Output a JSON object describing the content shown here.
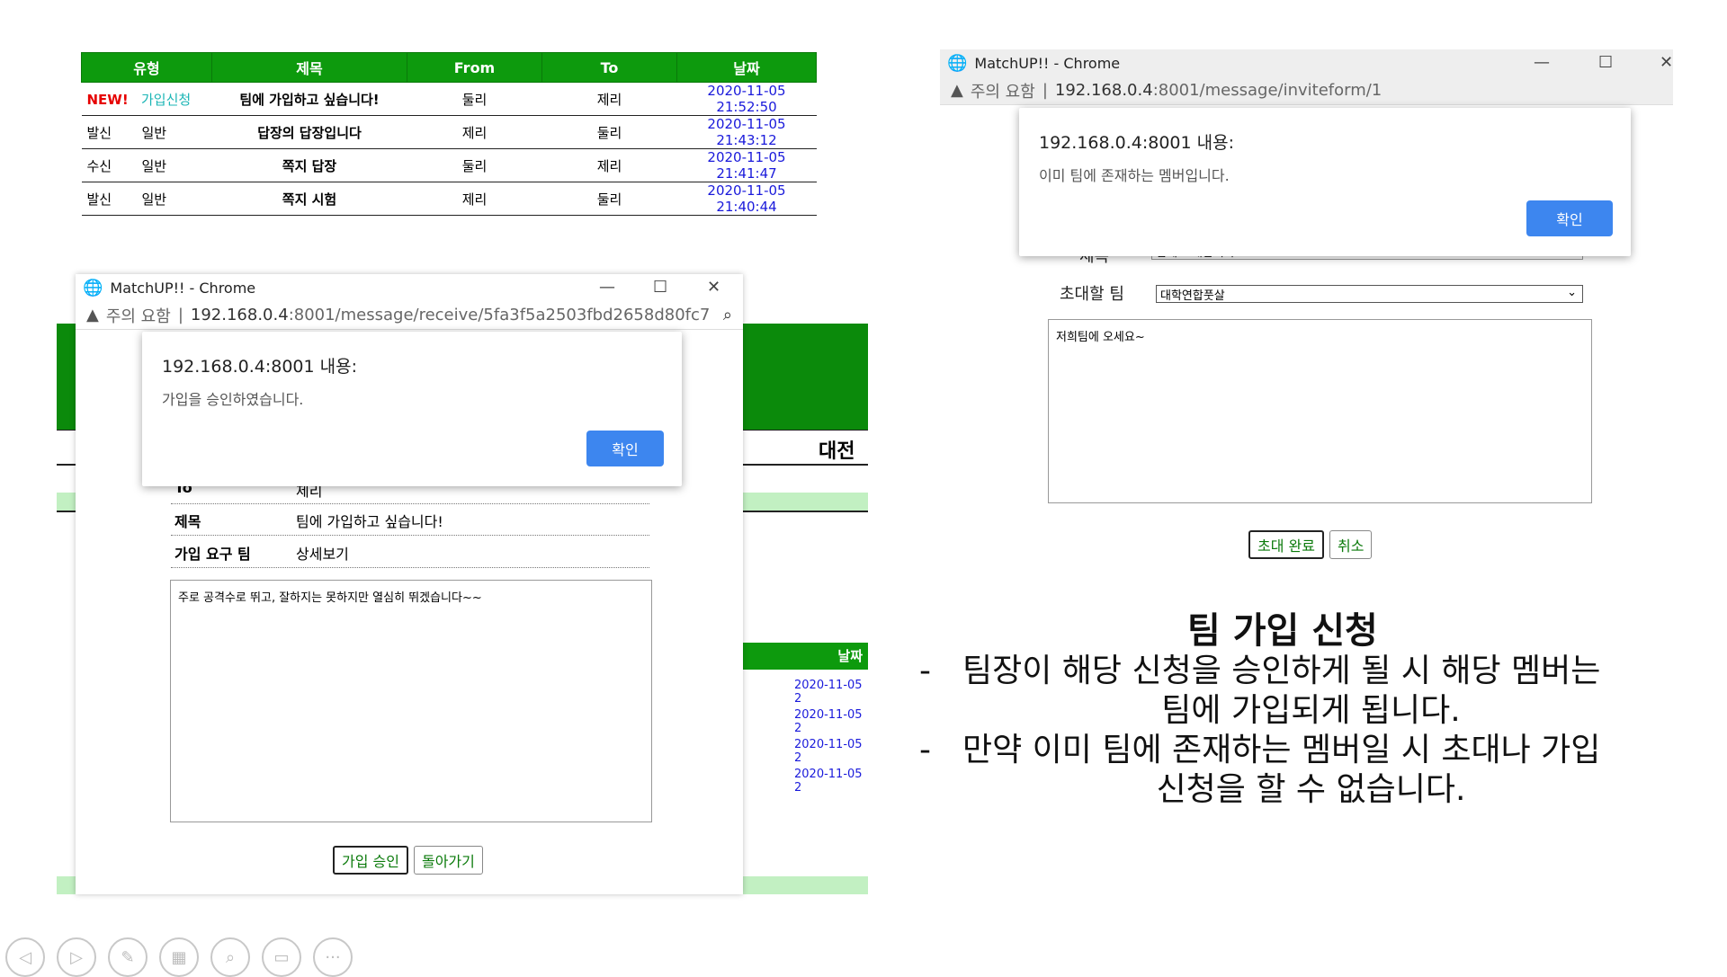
{
  "table": {
    "headers": [
      "유형",
      "제목",
      "From",
      "To",
      "날짜"
    ],
    "rows": [
      {
        "type1": "NEW!",
        "type2": "가입신청",
        "title": "팀에 가입하고 싶습니다!",
        "from": "둘리",
        "to": "제리",
        "date": "2020-11-05 21:52:50"
      },
      {
        "type1": "발신",
        "type2": "일반",
        "title": "답장의 답장입니다",
        "from": "제리",
        "to": "둘리",
        "date": "2020-11-05 21:43:12"
      },
      {
        "type1": "수신",
        "type2": "일반",
        "title": "쪽지 답장",
        "from": "둘리",
        "to": "제리",
        "date": "2020-11-05 21:41:47"
      },
      {
        "type1": "발신",
        "type2": "일반",
        "title": "쪽지 시험",
        "from": "제리",
        "to": "둘리",
        "date": "2020-11-05 21:40:44"
      }
    ]
  },
  "left_window": {
    "title": "MatchUP!! - Chrome",
    "warn": "주의 요함",
    "url_host": "192.168.0.4",
    "url_path": ":8001/message/receive/5fa3f5a2503fbd2658d80fc7",
    "dialog_title": "192.168.0.4:8001 내용:",
    "dialog_msg": "가입을 승인하였습니다.",
    "ok": "확인",
    "to_label": "To",
    "to_value": "제리",
    "subject_label": "제목",
    "subject_value": "팀에 가입하고 싶습니다!",
    "team_label": "가입 요구 팀",
    "team_value": "상세보기",
    "body": "주로 공격수로 뛰고, 잘하지는 못하지만 열심히 뛰겠습니다~~",
    "approve": "가입 승인",
    "back": "돌아가기",
    "bg_tab": "대전",
    "bg_date_header": "날짜",
    "bg_dates": [
      "2020-11-05 2",
      "2020-11-05 2",
      "2020-11-05 2",
      "2020-11-05 2"
    ]
  },
  "right_window": {
    "title": "MatchUP!! - Chrome",
    "warn": "주의 요함",
    "url_host": "192.168.0.4",
    "url_path": ":8001/message/inviteform/1",
    "dialog_title": "192.168.0.4:8001 내용:",
    "dialog_msg": "이미 팀에 존재하는 멤버입니다.",
    "ok": "확인",
    "subject_label": "제목",
    "subject_value": "팀에 초대합니다~~",
    "team_label": "초대할 팀",
    "team_value": "대학연합풋살",
    "body": "저희팀에 오세요~",
    "invite": "초대 완료",
    "cancel": "취소"
  },
  "caption": {
    "heading": "팀 가입 신청",
    "line1a": "팀장이 해당 신청을 승인하게 될 시 해당 멤버는",
    "line1b": "팀에 가입되게 됩니다.",
    "line2a": "만약 이미 팀에 존재하는 멤버일 시 초대나 가입",
    "line2b": "신청을 할 수 없습니다."
  },
  "nav_icons": [
    "prev-icon",
    "next-icon",
    "pen-icon",
    "slides-icon",
    "zoom-icon",
    "subtitles-icon",
    "more-icon"
  ]
}
